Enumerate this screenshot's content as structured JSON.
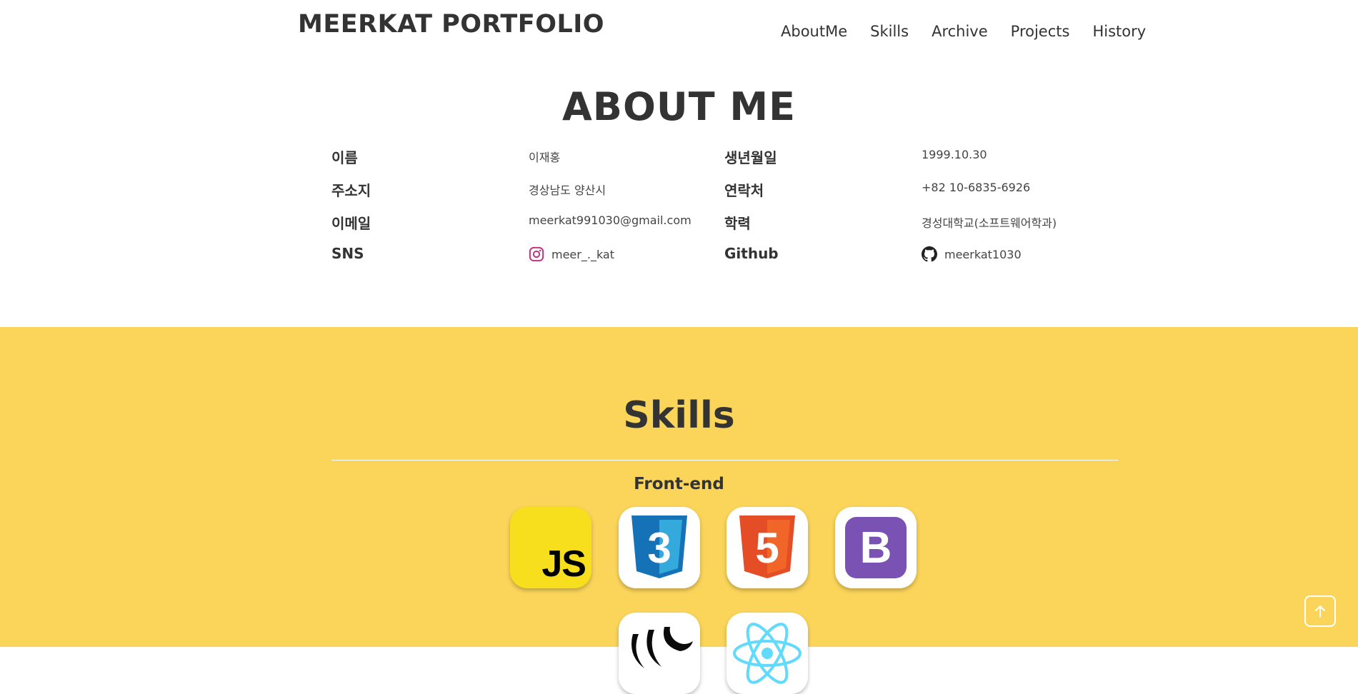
{
  "header": {
    "brand": "MEERKAT PORTFOLIO",
    "nav": [
      "AboutMe",
      "Skills",
      "Archive",
      "Projects",
      "History"
    ]
  },
  "about": {
    "title": "ABOUT ME",
    "rows": [
      {
        "l1": "이름",
        "v1": "이재홍",
        "l2": "생년월일",
        "v2": "1999.10.30"
      },
      {
        "l1": "주소지",
        "v1": "경상남도 양산시",
        "l2": "연락처",
        "v2": "+82 10-6835-6926"
      },
      {
        "l1": "이메일",
        "v1": "meerkat991030@gmail.com",
        "l2": "학력",
        "v2": "경성대학교(소프트웨어학과)"
      },
      {
        "l1": "SNS",
        "v1": "meer_._kat",
        "l2": "Github",
        "v2": "meerkat1030"
      }
    ],
    "icons": {
      "sns": "instagram-icon",
      "github": "github-icon"
    }
  },
  "skills": {
    "title": "Skills",
    "category": "Front-end",
    "items": [
      {
        "name": "JS",
        "icon": "javascript-icon"
      },
      {
        "name": "3",
        "icon": "css3-icon"
      },
      {
        "name": "5",
        "icon": "html5-icon"
      },
      {
        "name": "B",
        "icon": "bootstrap-icon"
      },
      {
        "name": "",
        "icon": "jquery-icon"
      },
      {
        "name": "",
        "icon": "react-icon"
      }
    ]
  },
  "colors": {
    "text": "#333333",
    "skills_bg": "#fbd55a",
    "js_yellow": "#f7df1e",
    "css_blue": "#1572b6",
    "html_orange": "#e44d26",
    "bootstrap_purple": "#7952b3",
    "react_cyan": "#61dafb",
    "instagram": "#c13584"
  },
  "scroll_top": {
    "icon": "arrow-up-icon"
  }
}
